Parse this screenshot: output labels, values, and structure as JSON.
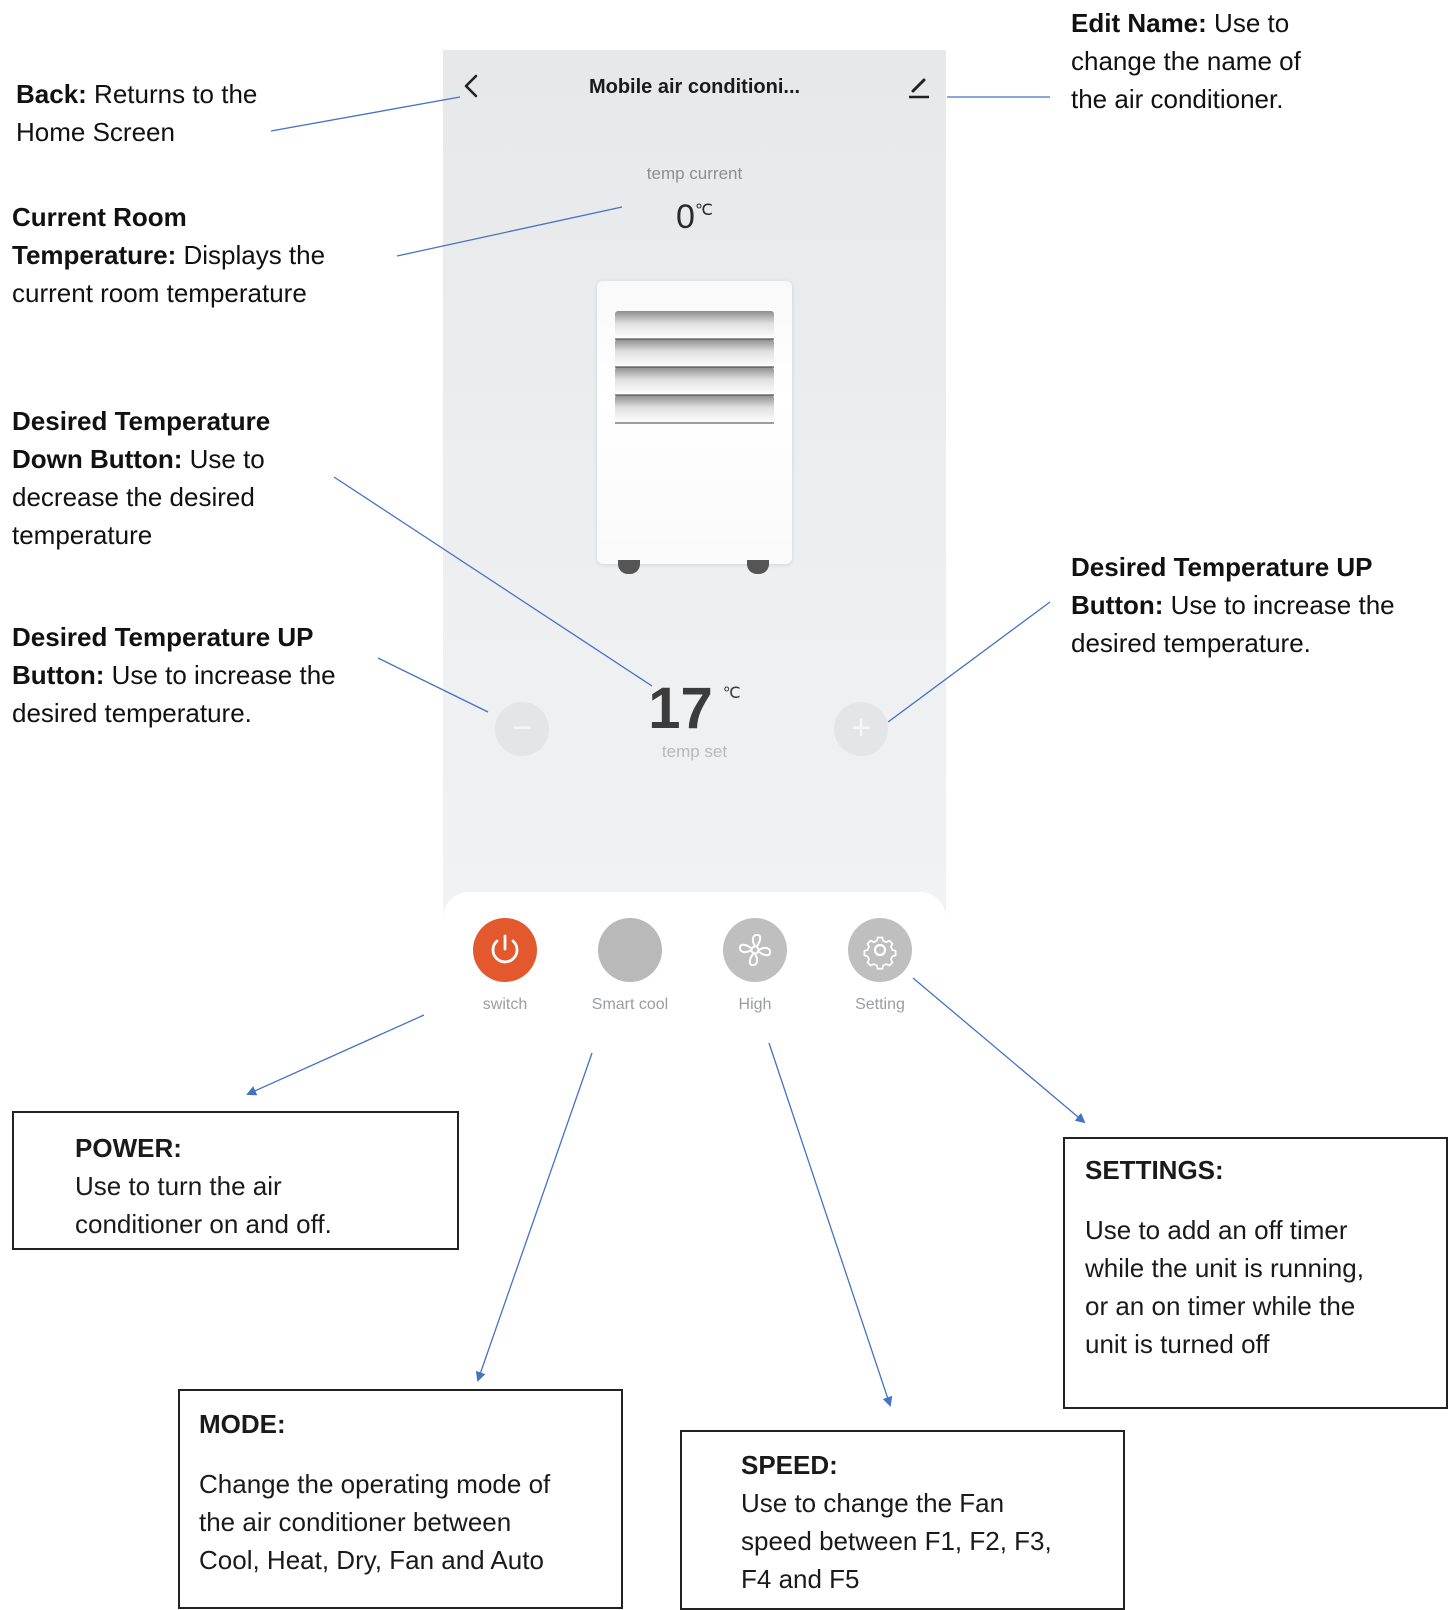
{
  "app": {
    "title": "Mobile air conditioni...",
    "temp_current_label": "temp current",
    "temp_current_value": "0",
    "temp_current_unit": "℃",
    "temp_set_value": "17",
    "temp_set_unit": "℃",
    "temp_set_label": "temp set",
    "minus_symbol": "−",
    "plus_symbol": "+",
    "controls": [
      {
        "label": "switch",
        "icon": "power-icon",
        "color": "#e3582d"
      },
      {
        "label": "Smart cool",
        "icon": "blank-circle",
        "color": "#b9b9b9"
      },
      {
        "label": "High",
        "icon": "fan-icon",
        "color": "#bfbfbf"
      },
      {
        "label": "Setting",
        "icon": "gear-icon",
        "color": "#bfbfbf"
      }
    ]
  },
  "annotations": {
    "back": {
      "head": "Back:",
      "text": " Returns to the",
      "line2": "Home Screen"
    },
    "edit": {
      "head": "Edit Name:",
      "text": " Use to",
      "line2": "change the name of",
      "line3": "the air conditioner."
    },
    "current": {
      "head1": "Current Room",
      "head2": "Temperature:",
      "text": " Displays the",
      "line3": "current room temperature"
    },
    "down": {
      "head1": "Desired Temperature",
      "head2": "Down Button:",
      "text": " Use to",
      "line3": "decrease the desired",
      "line4": "temperature"
    },
    "up_left": {
      "head1": "Desired Temperature UP",
      "head2": "Button:",
      "text": " Use to increase the",
      "line3": "desired temperature."
    },
    "up_right": {
      "head1": "Desired Temperature UP",
      "head2": "Button:",
      "text": " Use to increase the",
      "line3": "desired temperature."
    },
    "power": {
      "head": "POWER:",
      "line1": "Use to turn the air",
      "line2": "conditioner on and off."
    },
    "settings": {
      "head": "SETTINGS:",
      "line1": "Use to add an off timer",
      "line2": "while the unit is running,",
      "line3": "or an on timer while the",
      "line4": "unit is turned off"
    },
    "mode": {
      "head": "MODE:",
      "line1": "Change the operating mode of",
      "line2": "the air conditioner between",
      "line3": "Cool, Heat, Dry, Fan and Auto"
    },
    "speed": {
      "head": "SPEED:",
      "line1": "Use to change the Fan",
      "line2": "speed between F1, F2, F3,",
      "line3": "F4 and F5"
    }
  },
  "colors": {
    "accent": "#e3582d",
    "arrow": "#4472c4"
  }
}
